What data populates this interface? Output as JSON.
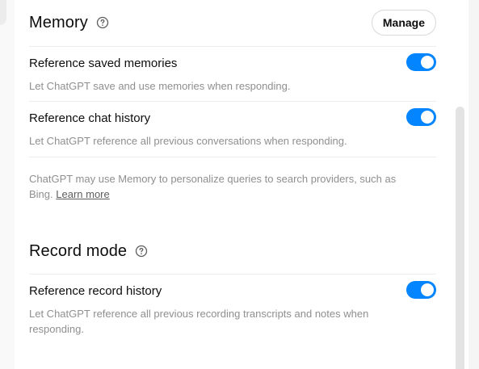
{
  "memory": {
    "title": "Memory",
    "help_icon": "question-circle-icon",
    "manage_label": "Manage",
    "settings": [
      {
        "label": "Reference saved memories",
        "description": "Let ChatGPT save and use memories when responding.",
        "enabled": true
      },
      {
        "label": "Reference chat history",
        "description": "Let ChatGPT reference all previous conversations when responding.",
        "enabled": true
      }
    ],
    "note_text": "ChatGPT may use Memory to personalize queries to search providers, such as Bing.",
    "learn_more_label": "Learn more"
  },
  "record_mode": {
    "title": "Record mode",
    "help_icon": "question-circle-icon",
    "settings": [
      {
        "label": "Reference record history",
        "description": "Let ChatGPT reference all previous recording transcripts and notes when responding.",
        "enabled": true
      }
    ]
  },
  "colors": {
    "toggle_on": "#0285ff",
    "text_primary": "#0d0d0d",
    "text_secondary": "#8f8f8f"
  }
}
